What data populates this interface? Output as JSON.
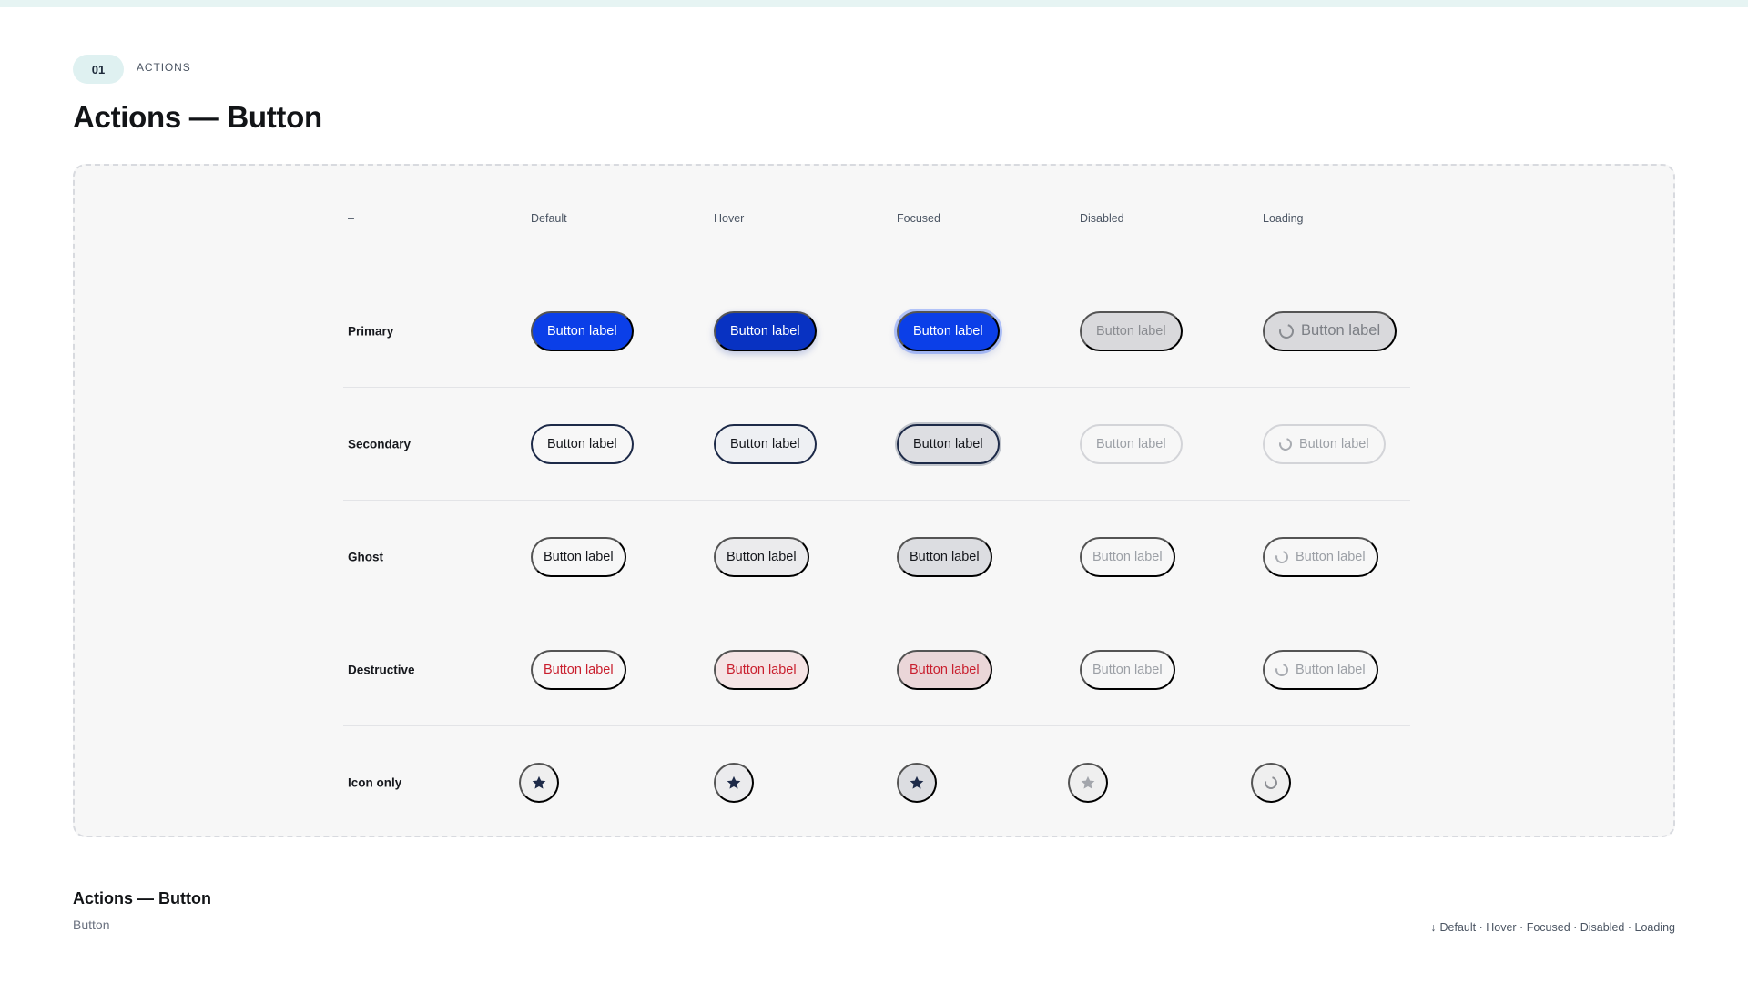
{
  "header": {
    "section_number": "01",
    "section_label": "ACTIONS",
    "title": "Actions — Button"
  },
  "matrix": {
    "corner_label": "–",
    "columns": [
      "Default",
      "Hover",
      "Focused",
      "Disabled",
      "Loading"
    ],
    "rows": [
      {
        "label": "Primary",
        "button_label": "Button label"
      },
      {
        "label": "Secondary",
        "button_label": "Button label"
      },
      {
        "label": "Ghost",
        "button_label": "Button label"
      },
      {
        "label": "Destructive",
        "button_label": "Button label"
      },
      {
        "label": "Icon only",
        "icon": "star-icon"
      }
    ]
  },
  "footer": {
    "title": "Actions — Button",
    "subtitle": "Button",
    "legend_arrow": "↓",
    "legend": "Default · Hover · Focused · Disabled · Loading"
  },
  "colors": {
    "primary": "#0b3fe8",
    "primary_hover": "#0832c2",
    "destructive": "#c91f2e",
    "ink": "#1d2a48",
    "disabled": "#d9d9dc",
    "accent_tint": "#dff1f1"
  }
}
